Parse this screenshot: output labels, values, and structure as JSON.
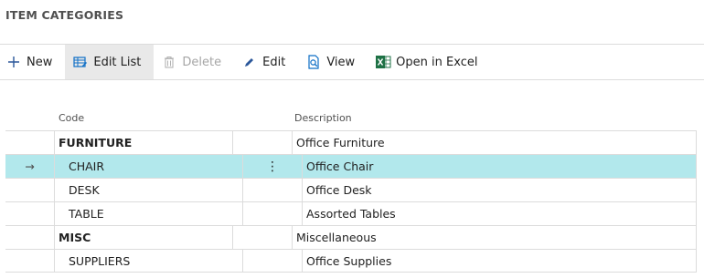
{
  "page": {
    "title": "ITEM CATEGORIES"
  },
  "toolbar": {
    "new_label": "New",
    "edit_list_label": "Edit List",
    "delete_label": "Delete",
    "edit_label": "Edit",
    "view_label": "View",
    "excel_label": "Open in Excel"
  },
  "grid": {
    "columns": {
      "code": "Code",
      "description": "Description"
    },
    "selected_indicator": "→",
    "row_menu_glyph": "⋮",
    "rows": [
      {
        "code": "FURNITURE",
        "description": "Office Furniture",
        "level": 0,
        "selected": false
      },
      {
        "code": "CHAIR",
        "description": "Office Chair",
        "level": 1,
        "selected": true
      },
      {
        "code": "DESK",
        "description": "Office Desk",
        "level": 1,
        "selected": false
      },
      {
        "code": "TABLE",
        "description": "Assorted Tables",
        "level": 1,
        "selected": false
      },
      {
        "code": "MISC",
        "description": "Miscellaneous",
        "level": 0,
        "selected": false
      },
      {
        "code": "SUPPLIERS",
        "description": "Office Supplies",
        "level": 1,
        "selected": false
      }
    ]
  },
  "colors": {
    "selected_row": "#b2e8ec",
    "excel_green": "#1e7145",
    "accent_blue": "#0f6fc6"
  },
  "icons": [
    "plus-icon",
    "edit-list-icon",
    "trash-icon",
    "pencil-icon",
    "view-icon",
    "excel-icon"
  ]
}
